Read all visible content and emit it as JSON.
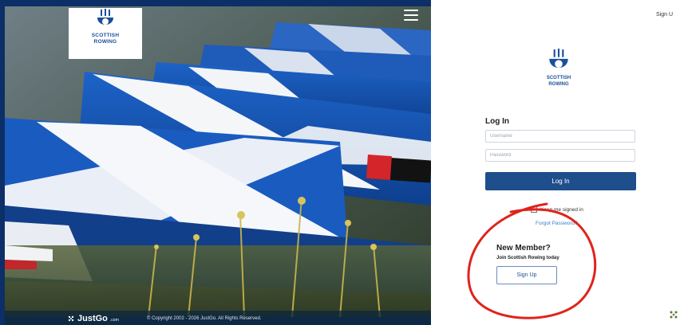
{
  "header": {
    "top_link": "Sign U",
    "menu_icon": "hamburger-icon"
  },
  "brand": {
    "logo_line1": "SCOTTISH",
    "logo_line2": "ROWING",
    "logo_icon": "rowing-crest-icon",
    "primary_color": "#1f4e8c"
  },
  "login": {
    "title": "Log In",
    "username_placeholder": "Username",
    "password_placeholder": "Password",
    "login_button": "Log In",
    "keep_signed_in": "Keep me signed in",
    "forgot_password": "Forgot Password?"
  },
  "signup": {
    "title": "New Member?",
    "subtitle": "Join Scottish Rowing today",
    "button": "Sign Up"
  },
  "footer": {
    "brand": "JustGo",
    "brand_suffix": ".com",
    "copyright": "© Copyright 2002 - 2026 JustGo. All Rights Reserved."
  },
  "annotation": {
    "shape": "red-hand-drawn-circle",
    "color": "#e0231b"
  }
}
